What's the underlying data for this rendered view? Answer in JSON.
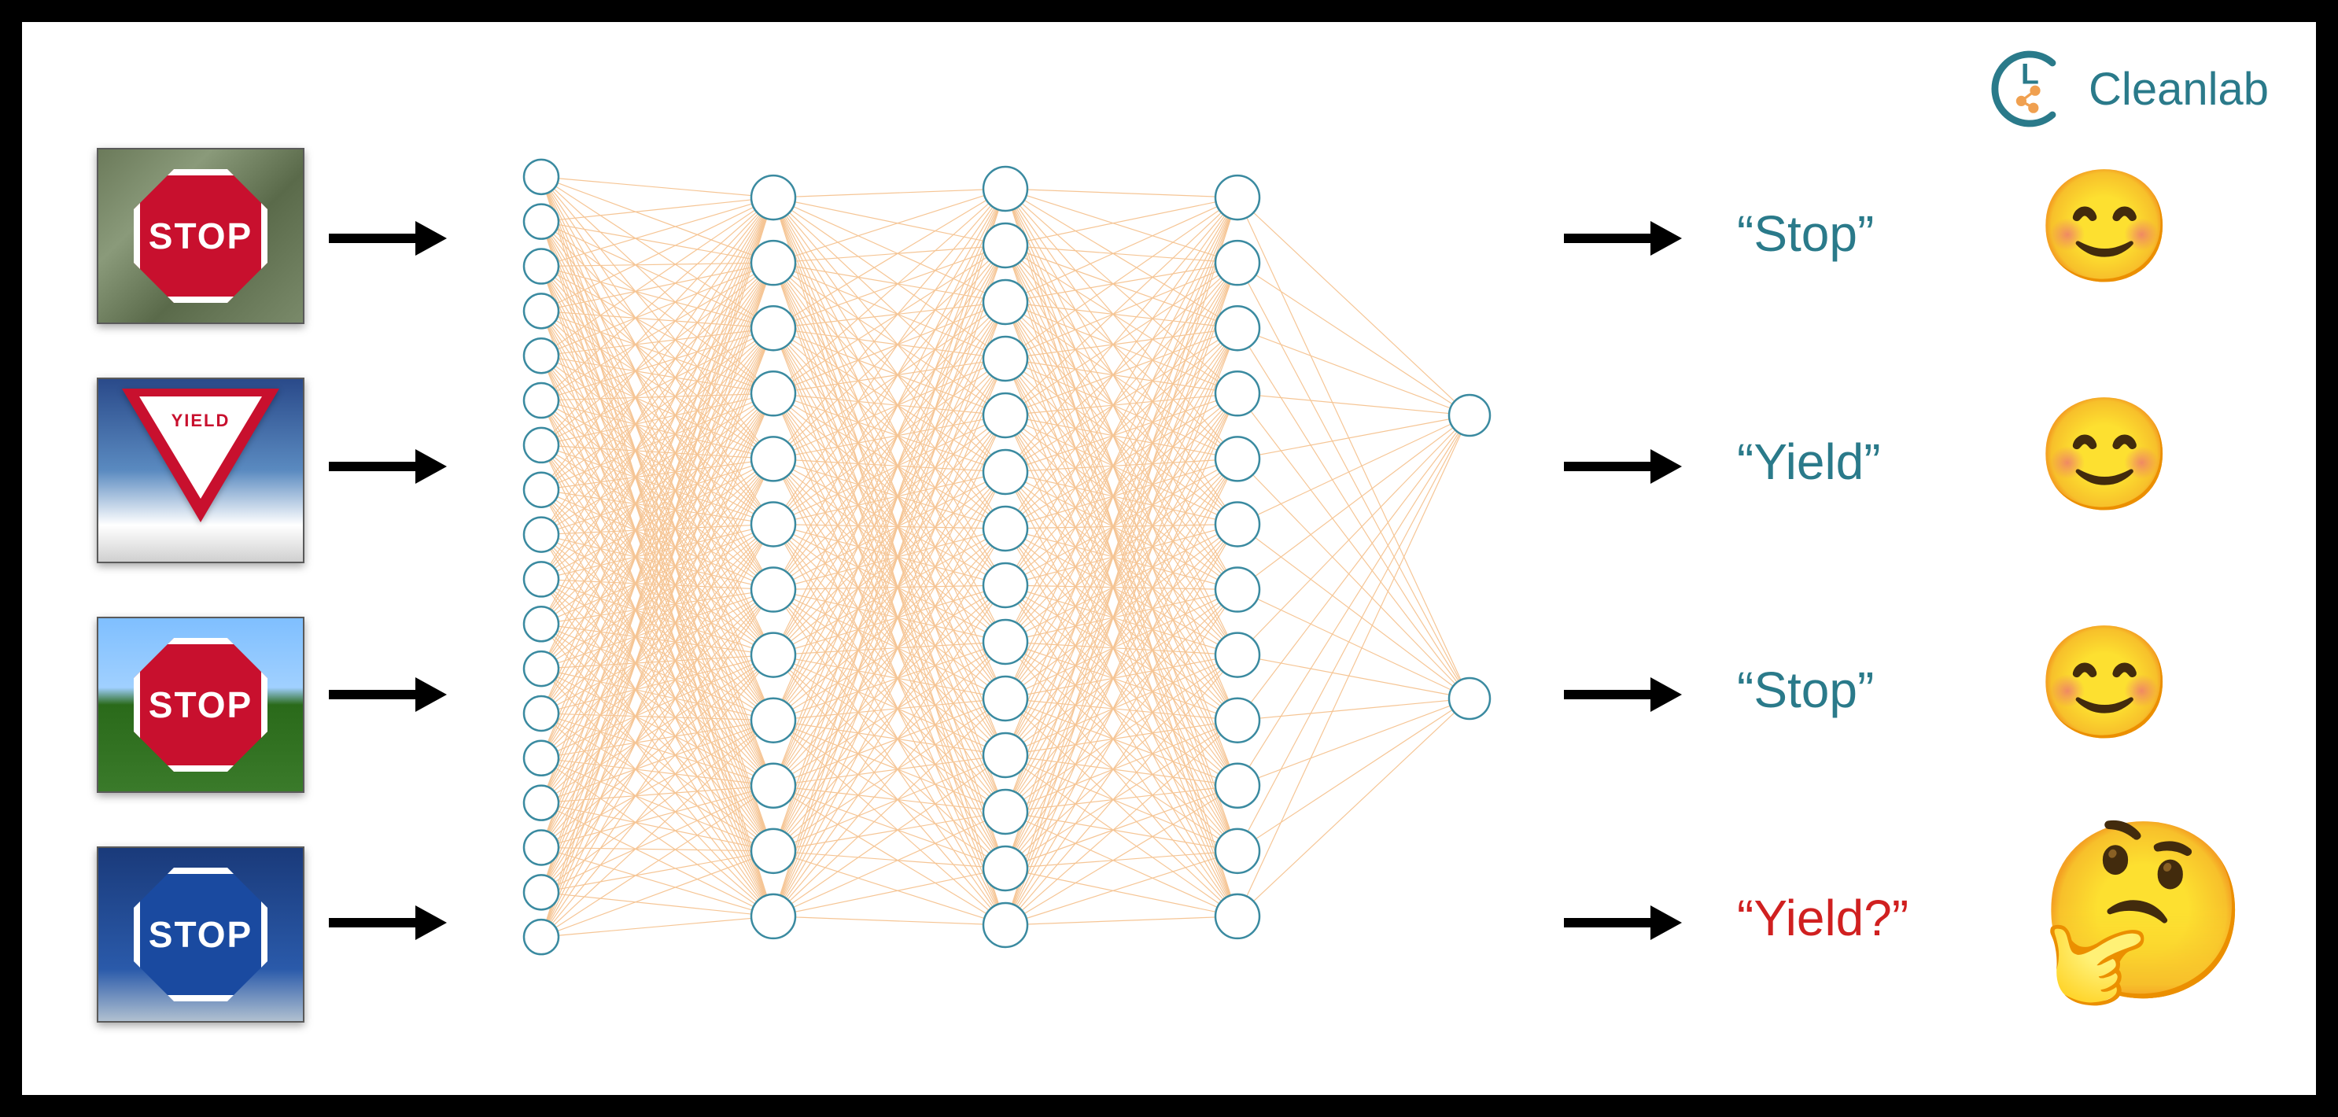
{
  "brand": {
    "name": "Cleanlab"
  },
  "inputs": [
    {
      "kind": "stop-sign-red",
      "sign_text": "STOP"
    },
    {
      "kind": "yield-sign",
      "sign_text": "YIELD"
    },
    {
      "kind": "stop-sign-red",
      "sign_text": "STOP"
    },
    {
      "kind": "stop-sign-blue",
      "sign_text": "STOP"
    }
  ],
  "outputs": [
    {
      "label": "“Stop”",
      "correct": true,
      "reaction": "smile"
    },
    {
      "label": "“Yield”",
      "correct": true,
      "reaction": "smile"
    },
    {
      "label": "“Stop”",
      "correct": true,
      "reaction": "smile"
    },
    {
      "label": "“Yield?”",
      "correct": false,
      "reaction": "thinking"
    }
  ],
  "network": {
    "layers": [
      18,
      12,
      14,
      12,
      2
    ],
    "colors": {
      "node_stroke": "#3a8aa0",
      "node_fill": "#ffffff",
      "edge": "#f0a050"
    }
  },
  "colors": {
    "text_teal": "#2a7a8a",
    "text_red": "#d02020",
    "stop_red": "#c8102e",
    "stop_blue": "#1a4aa0"
  }
}
